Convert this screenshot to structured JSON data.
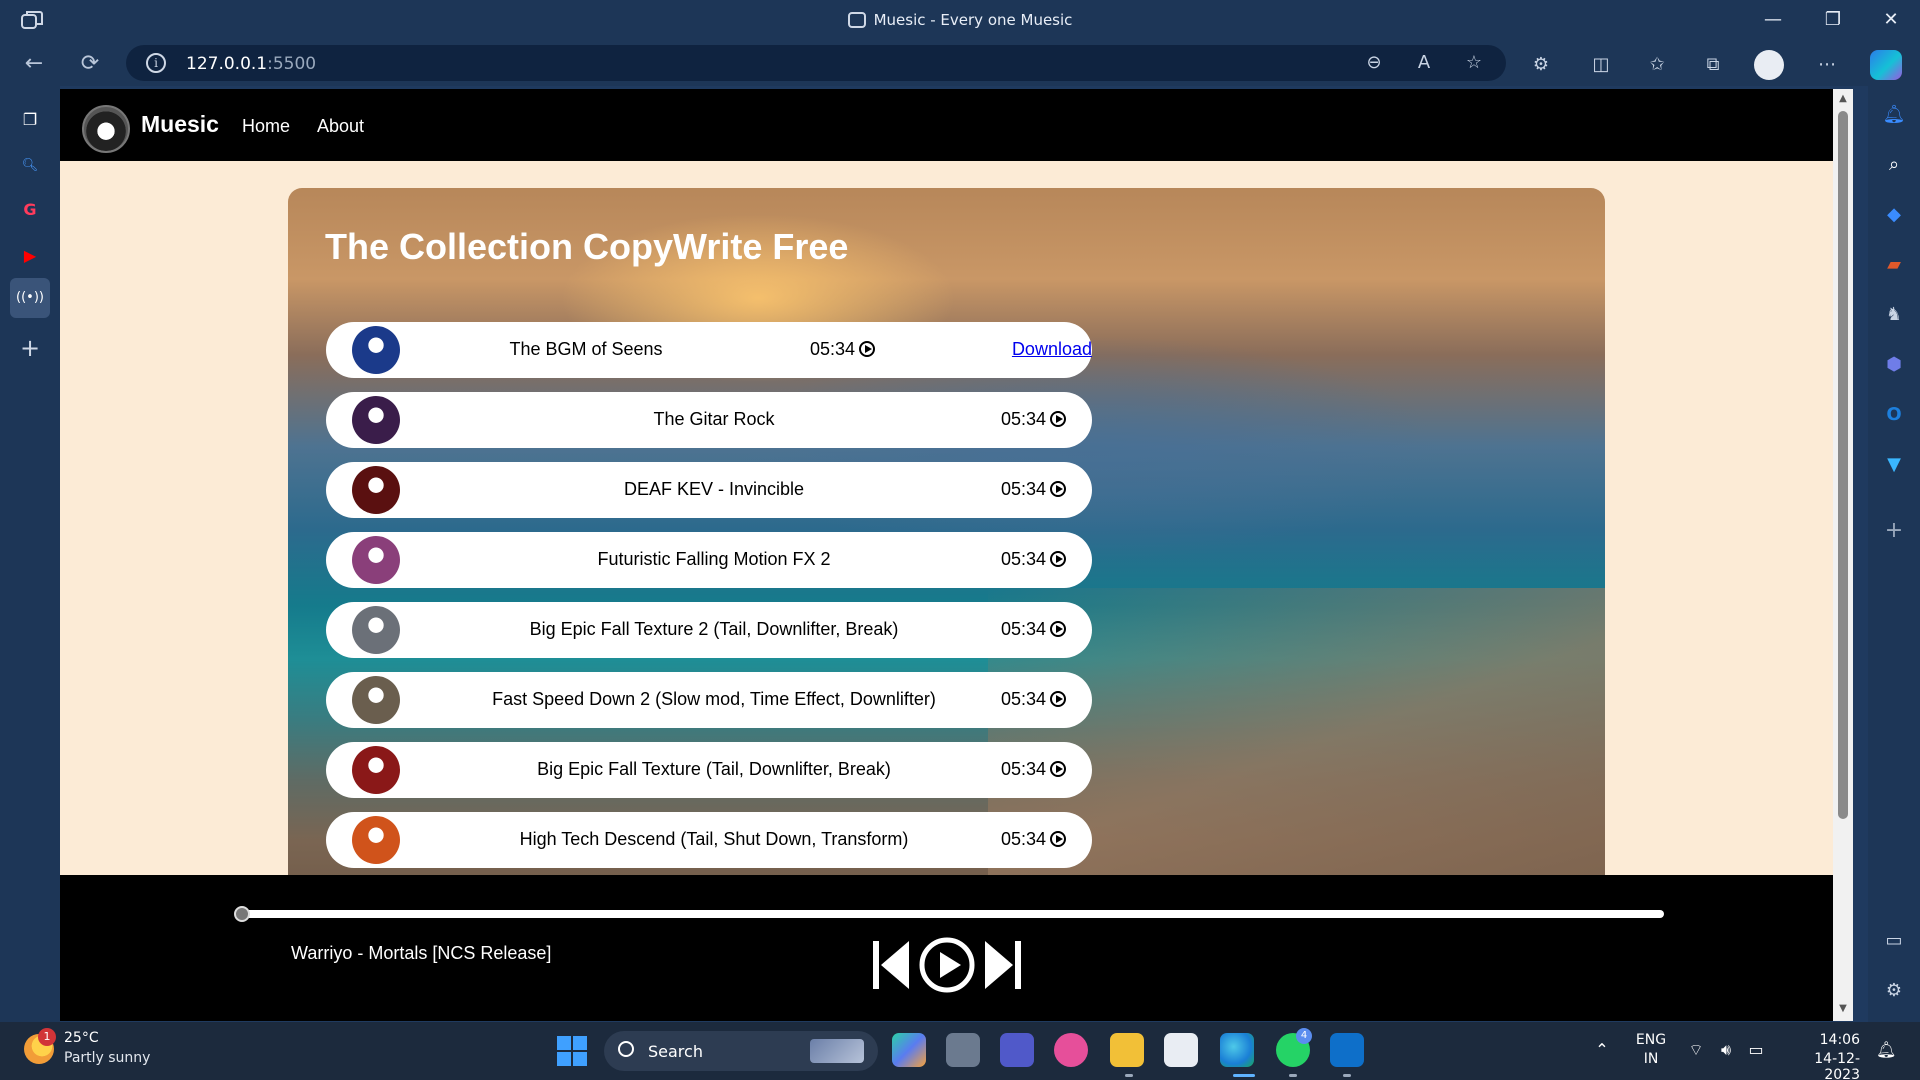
{
  "window": {
    "title": "Muesic - Every one Muesic",
    "minimize": "—",
    "restore": "❐",
    "close": "✕"
  },
  "address": {
    "url_host": "127.0.0.1",
    "url_port": ":5500"
  },
  "site": {
    "brand": "Muesic",
    "nav": [
      "Home",
      "About"
    ]
  },
  "hero": {
    "title": "The Collection CopyWrite Free"
  },
  "songs": [
    {
      "name": "The BGM of Seens",
      "time": "05:34",
      "download": "Download",
      "cover": "#1b3a8a"
    },
    {
      "name": "The Gitar Rock",
      "time": "05:34",
      "cover": "#3a1d4a"
    },
    {
      "name": "DEAF KEV - Invincible",
      "time": "05:34",
      "cover": "#5a1010"
    },
    {
      "name": "Futuristic Falling Motion FX 2",
      "time": "05:34",
      "cover": "#8a3f7a"
    },
    {
      "name": "Big Epic Fall Texture 2 (Tail, Downlifter, Break)",
      "time": "05:34",
      "cover": "#6b7078"
    },
    {
      "name": "Fast Speed Down 2 (Slow mod, Time Effect, Downlifter)",
      "time": "05:34",
      "cover": "#6a5e4e"
    },
    {
      "name": "Big Epic Fall Texture (Tail, Downlifter, Break)",
      "time": "05:34",
      "cover": "#8a1818"
    },
    {
      "name": "High Tech Descend (Tail, Shut Down, Transform)",
      "time": "05:34",
      "cover": "#d0531b"
    }
  ],
  "player": {
    "now_playing": "Warriyo - Mortals [NCS Release]",
    "progress": 0
  },
  "taskbar": {
    "weather_temp": "25°C",
    "weather_desc": "Partly sunny",
    "weather_badge": "1",
    "search": "Search",
    "whatsapp_badge": "4",
    "lang1": "ENG",
    "lang2": "IN",
    "time": "14:06",
    "date": "14-12-2023"
  }
}
